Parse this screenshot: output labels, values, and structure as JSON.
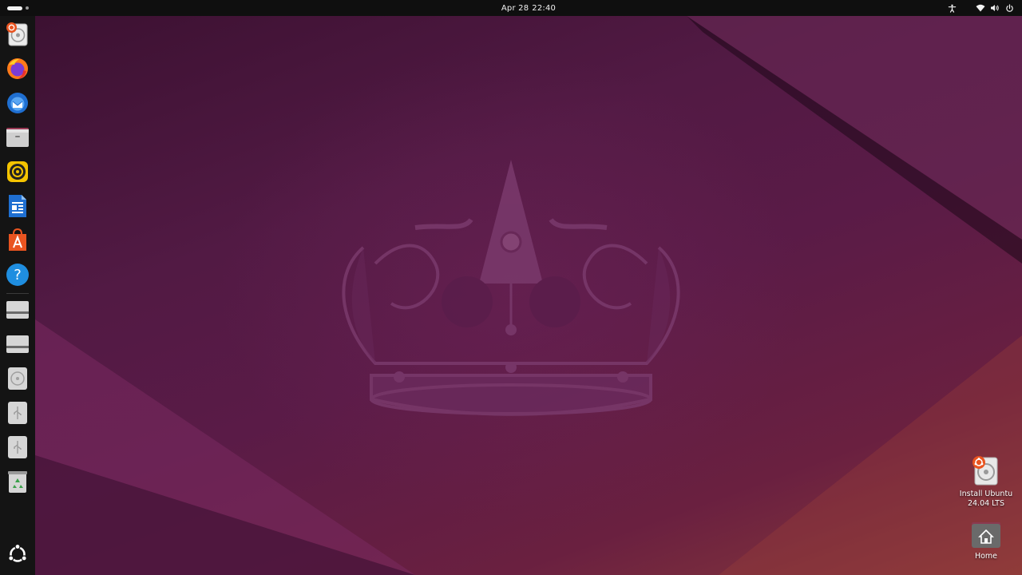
{
  "topbar": {
    "date": "Apr 28",
    "time": "22:40"
  },
  "dock": {
    "items": [
      {
        "name": "Install Ubuntu 24.04 LTS",
        "icon": "ubuntu-installer-icon"
      },
      {
        "name": "Firefox",
        "icon": "firefox-icon"
      },
      {
        "name": "Thunderbird Mail",
        "icon": "thunderbird-icon"
      },
      {
        "name": "Files",
        "icon": "files-icon"
      },
      {
        "name": "Rhythmbox",
        "icon": "rhythmbox-icon"
      },
      {
        "name": "LibreOffice Writer",
        "icon": "libreoffice-writer-icon"
      },
      {
        "name": "App Center",
        "icon": "app-center-icon"
      },
      {
        "name": "Help",
        "icon": "help-icon"
      },
      {
        "name": "Drive",
        "icon": "drive-icon"
      },
      {
        "name": "Drive",
        "icon": "drive-icon"
      },
      {
        "name": "Optical Drive",
        "icon": "optical-drive-icon"
      },
      {
        "name": "USB Drive",
        "icon": "usb-drive-icon"
      },
      {
        "name": "USB Drive",
        "icon": "usb-drive-icon"
      },
      {
        "name": "Trash",
        "icon": "trash-icon"
      },
      {
        "name": "Show Apps",
        "icon": "show-apps-icon"
      }
    ]
  },
  "desktop_icons": {
    "install": {
      "line1": "Install Ubuntu",
      "line2": "24.04 LTS"
    },
    "home": {
      "label": "Home"
    }
  },
  "colors": {
    "topbar": "#0f0f0f",
    "dock": "#141414",
    "wallpaper_base": "#521a44",
    "accent": "#e95420"
  }
}
